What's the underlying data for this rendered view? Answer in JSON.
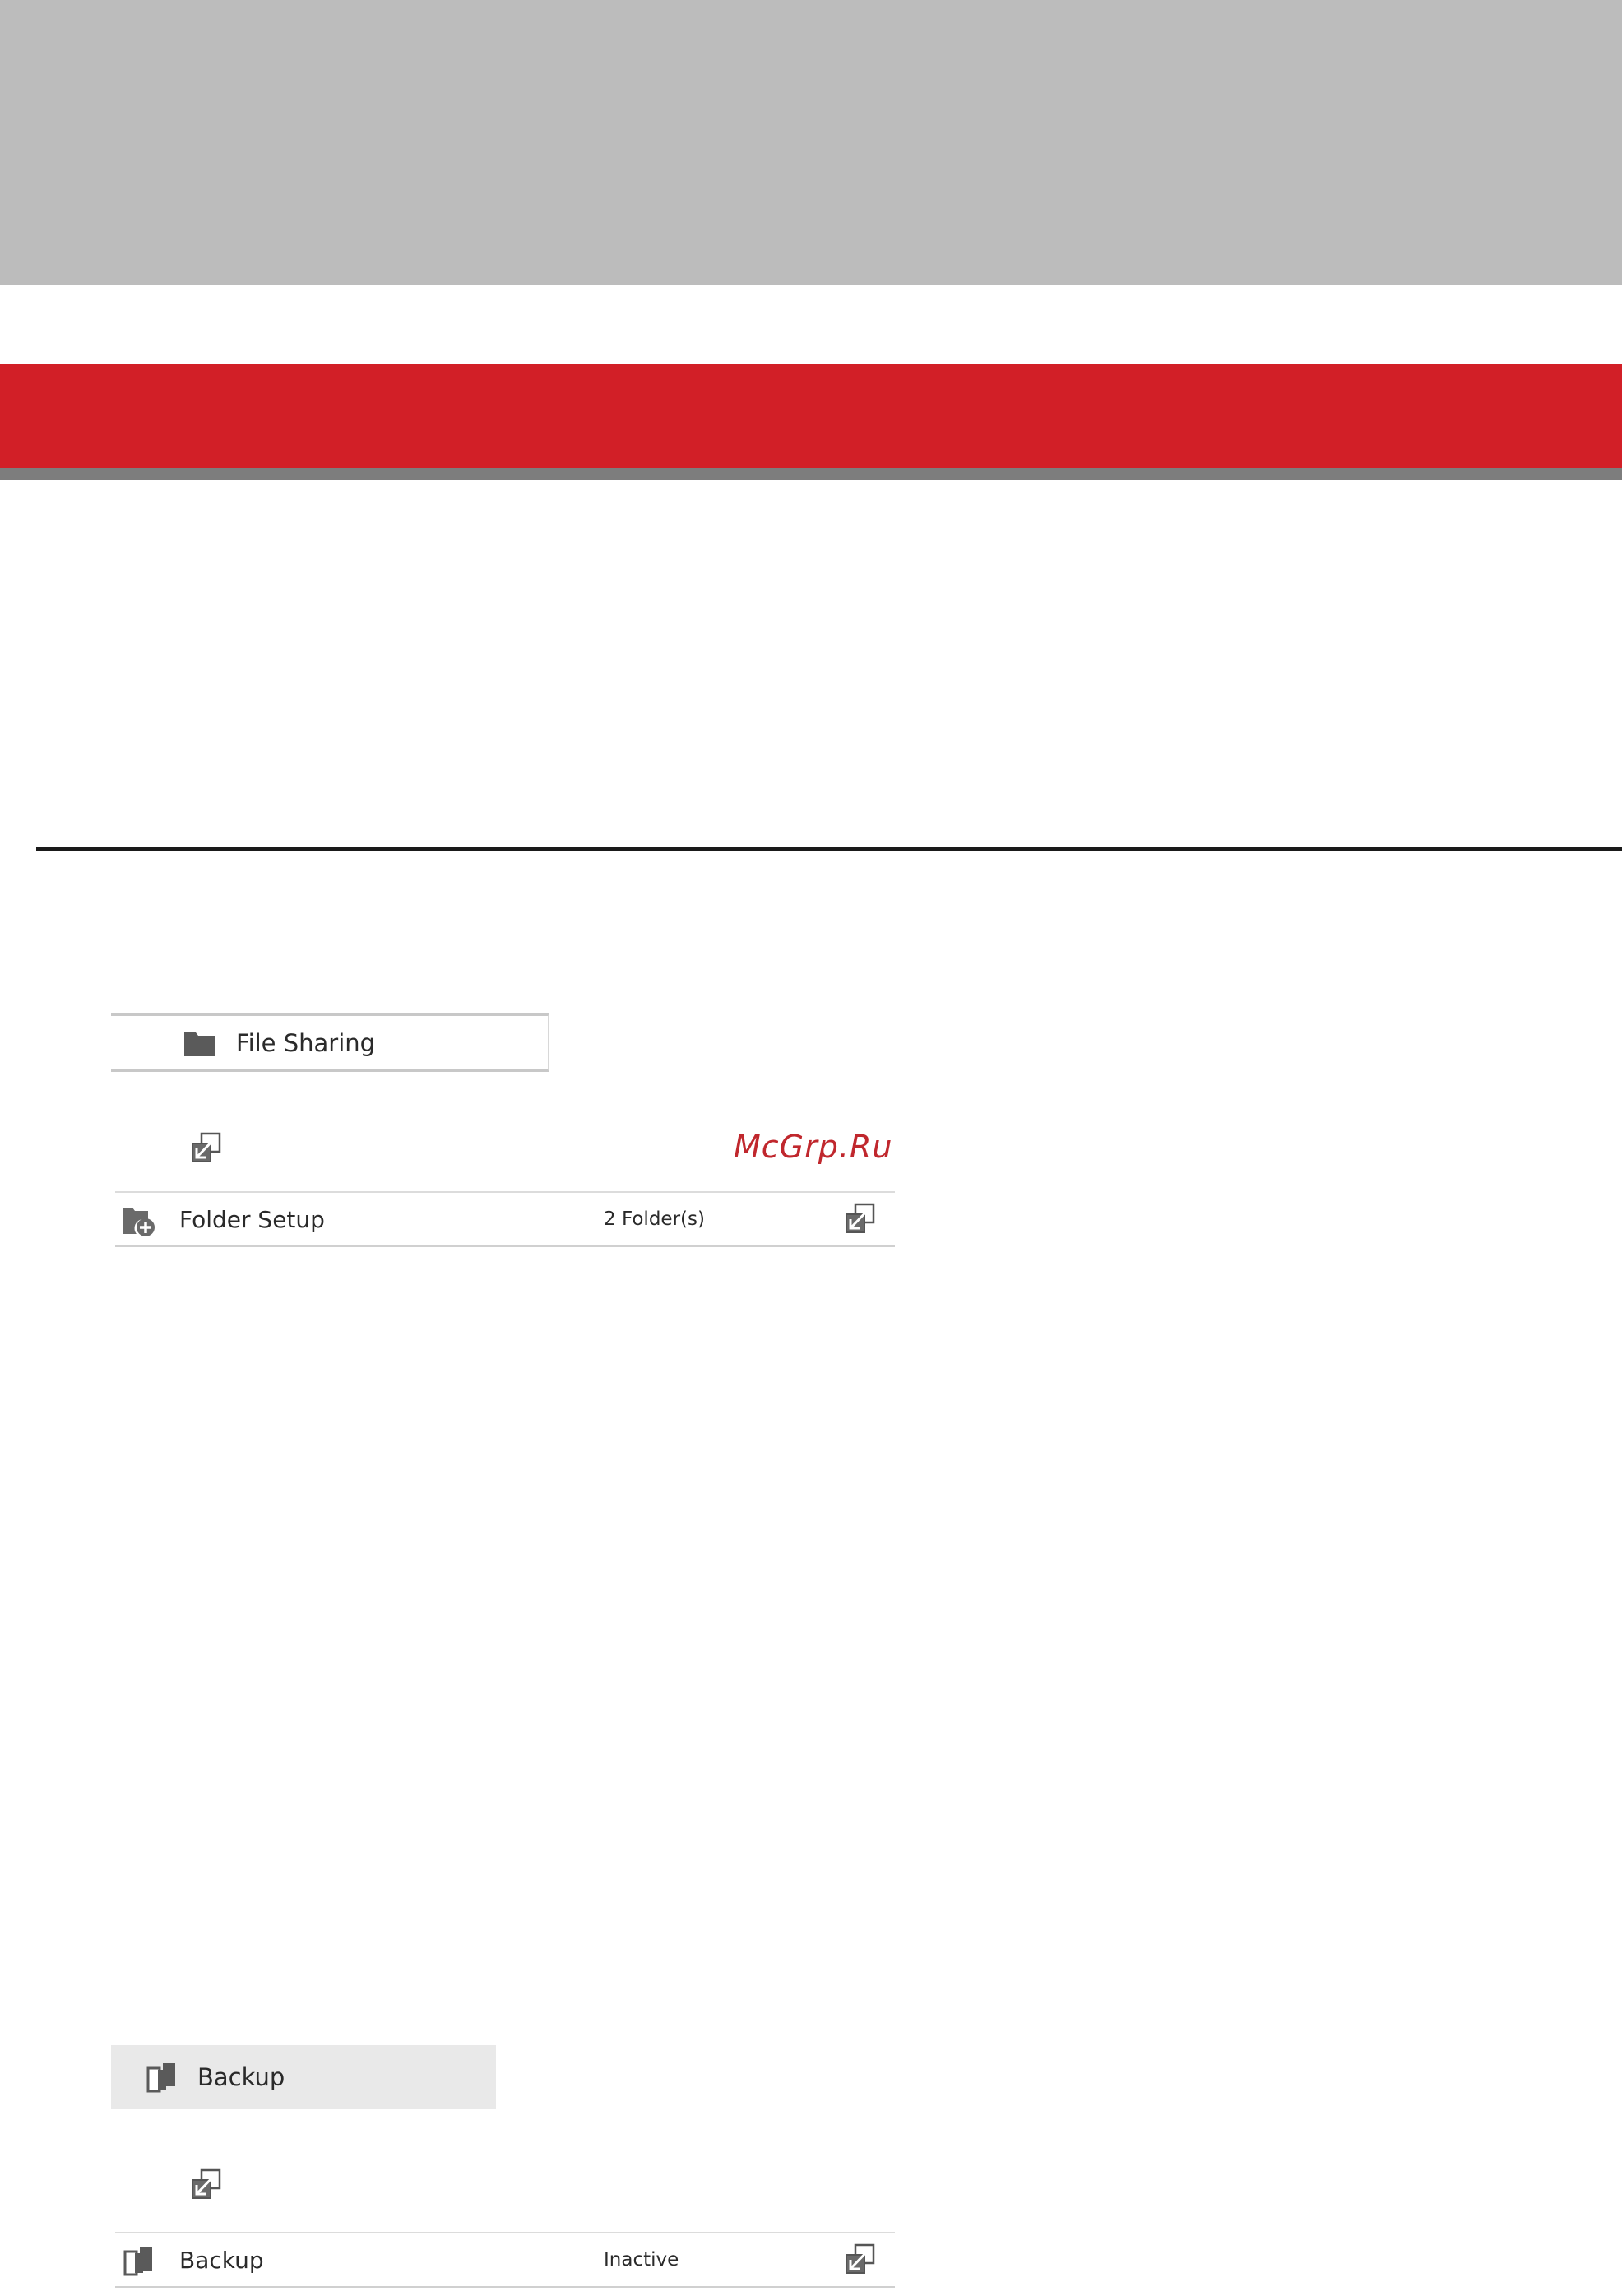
{
  "header": {
    "color": "#bcbcbc"
  },
  "banner": {
    "color": "#d21f27",
    "shadow_color": "#7d7d7d"
  },
  "nav": {
    "file_sharing": {
      "label": "File Sharing",
      "icon": "folder-icon"
    },
    "backup": {
      "label": "Backup",
      "icon": "backup-icon"
    }
  },
  "watermark": {
    "text": "McGrp.Ru",
    "color": "#c0272d"
  },
  "rows": [
    {
      "icon": "folder-add-icon",
      "label": "Folder Setup",
      "status": "2 Folder(s)",
      "action_icon": "open-settings-icon"
    },
    {
      "icon": "backup-icon",
      "label": "Backup",
      "status": "Inactive",
      "action_icon": "open-settings-icon"
    }
  ]
}
